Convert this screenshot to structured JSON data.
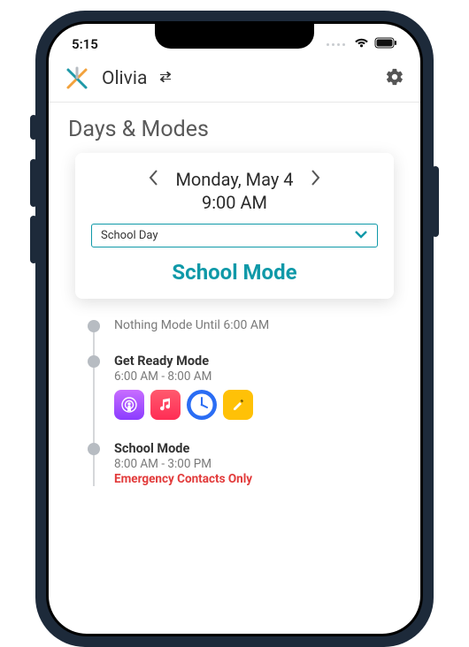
{
  "status": {
    "time": "5:15"
  },
  "header": {
    "profile_name": "Olivia"
  },
  "page": {
    "title": "Days & Modes"
  },
  "card": {
    "date": "Monday, May 4",
    "time": "9:00 AM",
    "select_value": "School Day",
    "mode_label": "School Mode"
  },
  "timeline": [
    {
      "title": "",
      "muted": "Nothing Mode Until 6:00 AM",
      "range": "",
      "alert": "",
      "apps": []
    },
    {
      "title": "Get Ready Mode",
      "muted": "",
      "range": "6:00 AM - 8:00 AM",
      "alert": "",
      "apps": [
        "podcast",
        "music",
        "clock",
        "notes"
      ]
    },
    {
      "title": "School Mode",
      "muted": "",
      "range": "8:00 AM - 3:00 PM",
      "alert": "Emergency Contacts Only",
      "apps": []
    }
  ]
}
